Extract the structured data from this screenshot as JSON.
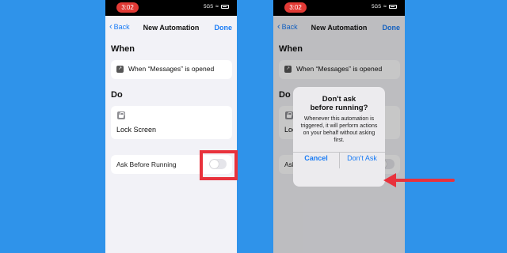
{
  "status_bar": {
    "time": "3:02",
    "network": "5GS"
  },
  "nav": {
    "back_label": "Back",
    "title": "New Automation",
    "done_label": "Done"
  },
  "when": {
    "heading": "When",
    "trigger_text": "When “Messages” is opened"
  },
  "do": {
    "heading": "Do",
    "action_text": "Lock Screen"
  },
  "ask_before_running": {
    "label": "Ask Before Running",
    "enabled": false
  },
  "alert": {
    "title_line1": "Don't ask",
    "title_line2": "before running?",
    "message": "Whenever this automation is triggered, it will perform actions on your behalf without asking first.",
    "cancel_label": "Cancel",
    "confirm_label": "Don't Ask"
  },
  "colors": {
    "background": "#2f93ea",
    "accent": "#1a7cf5",
    "highlight": "#e8323c"
  }
}
